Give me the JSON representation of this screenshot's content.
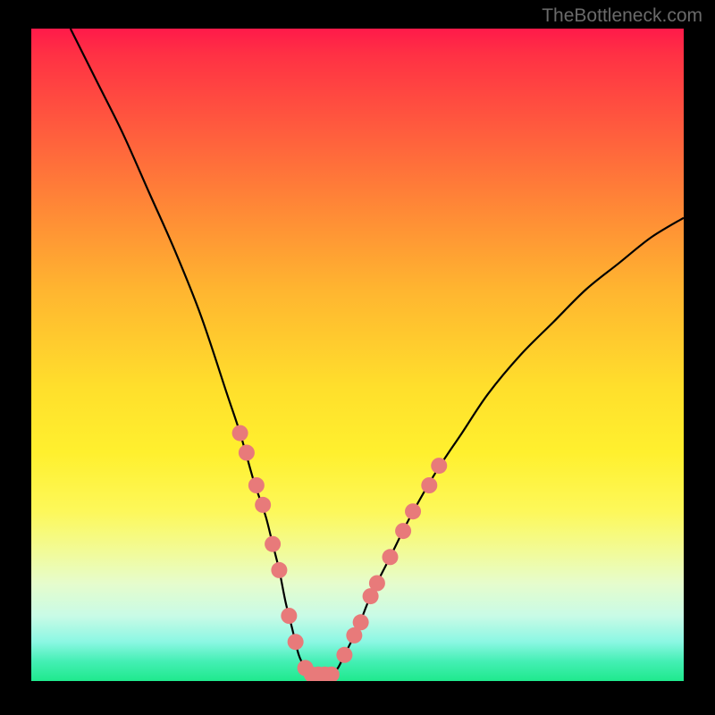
{
  "watermark": "TheBottleneck.com",
  "chart_data": {
    "type": "line",
    "title": "",
    "xlabel": "",
    "ylabel": "",
    "xlim": [
      0,
      100
    ],
    "ylim": [
      0,
      100
    ],
    "grid": false,
    "series": [
      {
        "name": "curve",
        "color": "#000000",
        "x": [
          6,
          10,
          14,
          18,
          22,
          26,
          30,
          32,
          34,
          35,
          36,
          37,
          38,
          39,
          40,
          41,
          42,
          43,
          44,
          45,
          46,
          47,
          48,
          50,
          52,
          55,
          58,
          62,
          66,
          70,
          75,
          80,
          85,
          90,
          95,
          100
        ],
        "y": [
          100,
          92,
          84,
          75,
          66,
          56,
          44,
          38,
          31,
          28,
          25,
          21,
          17,
          12,
          8,
          4,
          2,
          1,
          1,
          1,
          1,
          2,
          4,
          8,
          13,
          19,
          25,
          32,
          38,
          44,
          50,
          55,
          60,
          64,
          68,
          71
        ]
      }
    ],
    "markers": [
      {
        "x": 32.0,
        "y": 38
      },
      {
        "x": 33.0,
        "y": 35
      },
      {
        "x": 34.5,
        "y": 30
      },
      {
        "x": 35.5,
        "y": 27
      },
      {
        "x": 37.0,
        "y": 21
      },
      {
        "x": 38.0,
        "y": 17
      },
      {
        "x": 39.5,
        "y": 10
      },
      {
        "x": 40.5,
        "y": 6
      },
      {
        "x": 42.0,
        "y": 2
      },
      {
        "x": 43.0,
        "y": 1
      },
      {
        "x": 44.0,
        "y": 1
      },
      {
        "x": 45.0,
        "y": 1
      },
      {
        "x": 46.0,
        "y": 1
      },
      {
        "x": 48.0,
        "y": 4
      },
      {
        "x": 49.5,
        "y": 7
      },
      {
        "x": 50.5,
        "y": 9
      },
      {
        "x": 52.0,
        "y": 13
      },
      {
        "x": 53.0,
        "y": 15
      },
      {
        "x": 55.0,
        "y": 19
      },
      {
        "x": 57.0,
        "y": 23
      },
      {
        "x": 58.5,
        "y": 26
      },
      {
        "x": 61.0,
        "y": 30
      },
      {
        "x": 62.5,
        "y": 33
      }
    ],
    "marker_color": "#e87a7a",
    "gradient_stops": [
      {
        "pos": 0,
        "color": "#ff1a4a"
      },
      {
        "pos": 15,
        "color": "#ff5a3e"
      },
      {
        "pos": 40,
        "color": "#ffb530"
      },
      {
        "pos": 65,
        "color": "#fff02e"
      },
      {
        "pos": 85,
        "color": "#e6fccc"
      },
      {
        "pos": 100,
        "color": "#1fe98d"
      }
    ]
  }
}
